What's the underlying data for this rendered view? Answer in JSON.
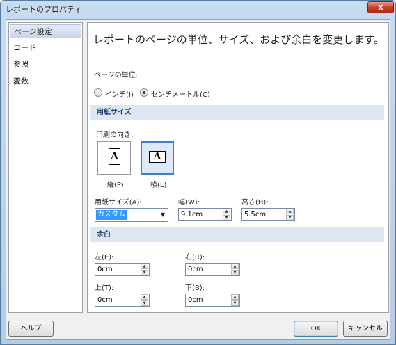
{
  "window": {
    "title": "レポートのプロパティ",
    "close_glyph": "x"
  },
  "sidebar": {
    "items": [
      {
        "label": "ページ設定"
      },
      {
        "label": "コード"
      },
      {
        "label": "参照"
      },
      {
        "label": "変数"
      }
    ]
  },
  "main": {
    "heading": "レポートのページの単位、サイズ、および余白を変更します。",
    "units": {
      "label": "ページの単位:",
      "options": [
        {
          "label": "インチ(I)",
          "checked": false
        },
        {
          "label": "センチメートル(C)",
          "checked": true
        }
      ]
    },
    "paper": {
      "section_title": "用紙サイズ",
      "orientation_label": "印刷の向き:",
      "portrait_label": "縦(P)",
      "landscape_label": "横(L)",
      "page_icon_glyph": "A",
      "size_label": "用紙サイズ(A):",
      "size_value": "カスタム",
      "width_label": "幅(W):",
      "width_value": "9.1cm",
      "height_label": "高さ(H):",
      "height_value": "5.5cm"
    },
    "margins": {
      "section_title": "余白",
      "left_label": "左(E):",
      "left_value": "0cm",
      "right_label": "右(R):",
      "right_value": "0cm",
      "top_label": "上(T):",
      "top_value": "0cm",
      "bottom_label": "下(B):",
      "bottom_value": "0cm"
    }
  },
  "footer": {
    "help_label": "ヘルプ",
    "ok_label": "OK",
    "cancel_label": "キャンセル"
  },
  "colors": {
    "section_header_bg": "#dde7f2",
    "selection_blue": "#3399ff",
    "selected_orientation": "#3a80d0"
  }
}
